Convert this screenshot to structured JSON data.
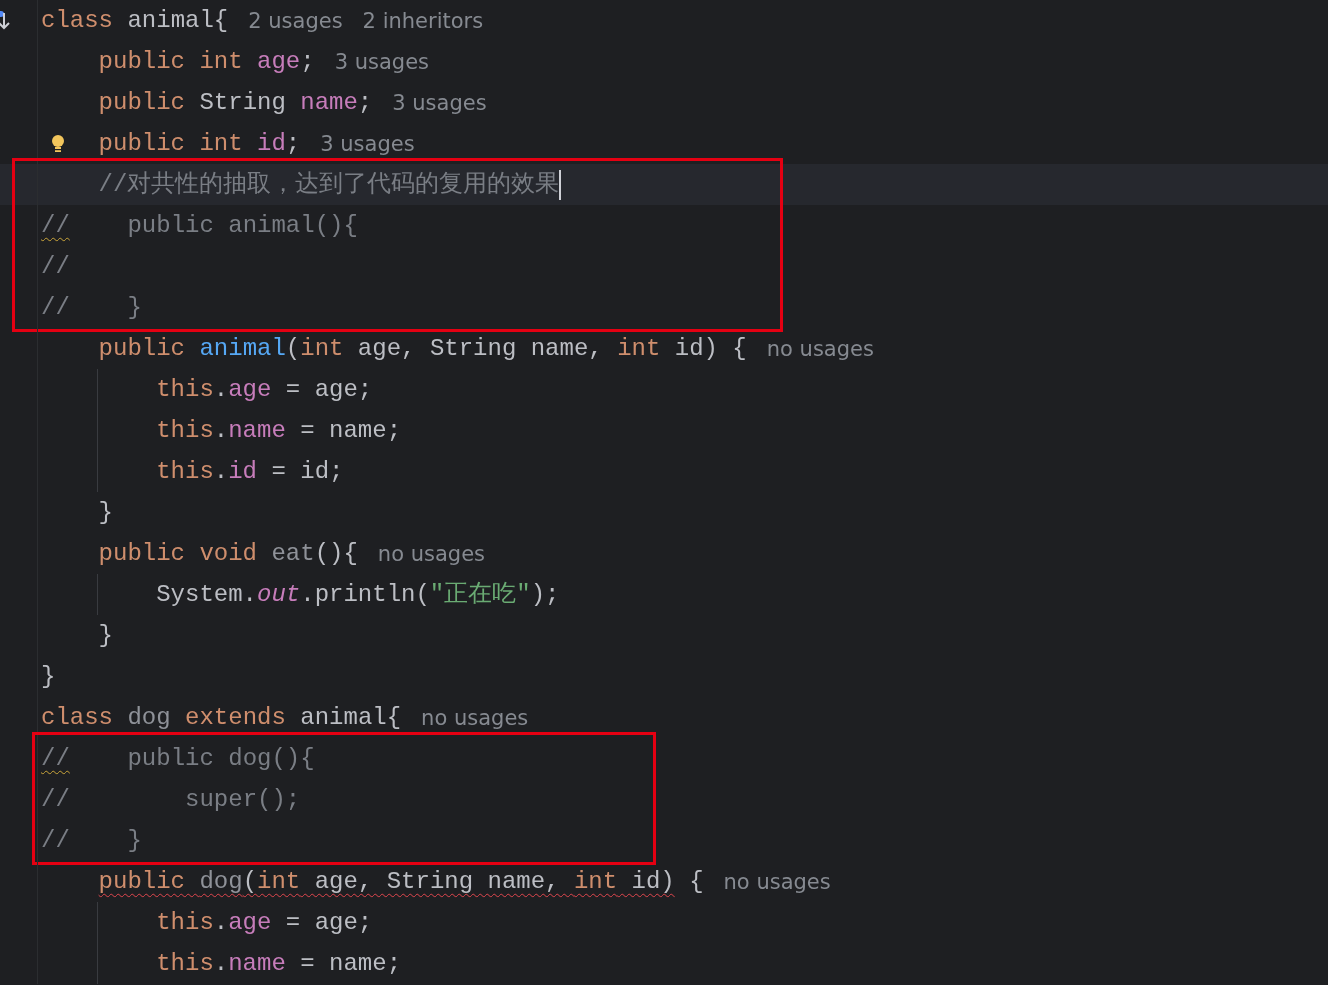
{
  "editor": {
    "blocks": [
      {
        "framed": false,
        "lines": [
          {
            "gutter": {
              "kind": "implemented"
            },
            "current": false,
            "tokens": [
              {
                "t": "class",
                "kind": "keyword"
              },
              {
                "t": " animal{",
                "kind": "plain"
              }
            ],
            "hints": [
              "2 usages",
              "2 inheritors"
            ]
          },
          {
            "current": false,
            "tokens": [
              {
                "t": "    public int ",
                "kind": "keyword"
              },
              {
                "t": "age",
                "kind": "field"
              },
              {
                "t": ";",
                "kind": "plain"
              }
            ],
            "hints": [
              "3 usages"
            ]
          },
          {
            "current": false,
            "tokens": [
              {
                "t": "    public",
                "kind": "keyword"
              },
              {
                "t": " String ",
                "kind": "plain"
              },
              {
                "t": "name",
                "kind": "field"
              },
              {
                "t": ";",
                "kind": "plain"
              }
            ],
            "hints": [
              "3 usages"
            ]
          },
          {
            "gutter": {
              "kind": "bulb"
            },
            "current": false,
            "tokens": [
              {
                "t": "    public int ",
                "kind": "keyword"
              },
              {
                "t": "id",
                "kind": "field"
              },
              {
                "t": ";",
                "kind": "plain"
              }
            ],
            "hints": [
              "3 usages"
            ]
          }
        ]
      },
      {
        "framed": true,
        "lines": [
          {
            "current": true,
            "tokens": [
              {
                "t": "    //对共性的抽取，达到了代码的复用的效果",
                "kind": "comment"
              }
            ]
          },
          {
            "current": false,
            "tokens": [
              {
                "t": "//",
                "kind": "comment",
                "squiggle": {
                  "kind": "warning"
                }
              },
              {
                "t": "    public animal(){",
                "kind": "comment"
              }
            ]
          },
          {
            "current": false,
            "tokens": [
              {
                "t": "//",
                "kind": "comment"
              }
            ]
          },
          {
            "current": false,
            "tokens": [
              {
                "t": "//    }",
                "kind": "comment"
              }
            ]
          }
        ]
      },
      {
        "framed": false,
        "lines": [
          {
            "current": false,
            "tokens": [
              {
                "t": "    public ",
                "kind": "keyword"
              },
              {
                "t": "animal",
                "kind": "declaration"
              },
              {
                "t": "(",
                "kind": "plain"
              },
              {
                "t": "int",
                "kind": "keyword"
              },
              {
                "t": " age, String name, ",
                "kind": "plain"
              },
              {
                "t": "int",
                "kind": "keyword"
              },
              {
                "t": " id) {",
                "kind": "plain"
              }
            ],
            "hints": [
              "no usages"
            ]
          },
          {
            "current": false,
            "tokens": [
              {
                "t": "        this",
                "kind": "keyword"
              },
              {
                "t": ".",
                "kind": "plain"
              },
              {
                "t": "age",
                "kind": "field"
              },
              {
                "t": " = age;",
                "kind": "plain"
              }
            ]
          },
          {
            "current": false,
            "tokens": [
              {
                "t": "        this",
                "kind": "keyword"
              },
              {
                "t": ".",
                "kind": "plain"
              },
              {
                "t": "name",
                "kind": "field"
              },
              {
                "t": " = name;",
                "kind": "plain"
              }
            ]
          },
          {
            "current": false,
            "tokens": [
              {
                "t": "        this",
                "kind": "keyword"
              },
              {
                "t": ".",
                "kind": "plain"
              },
              {
                "t": "id",
                "kind": "field"
              },
              {
                "t": " = id;",
                "kind": "plain"
              }
            ]
          },
          {
            "current": false,
            "tokens": [
              {
                "t": "    }",
                "kind": "plain"
              }
            ]
          },
          {
            "current": false,
            "tokens": [
              {
                "t": "    public void ",
                "kind": "keyword"
              },
              {
                "t": "eat",
                "kind": "unused"
              },
              {
                "t": "(){",
                "kind": "plain"
              }
            ],
            "hints": [
              "no usages"
            ]
          },
          {
            "current": false,
            "tokens": [
              {
                "t": "        System.",
                "kind": "plain"
              },
              {
                "t": "out",
                "kind": "static"
              },
              {
                "t": ".println(",
                "kind": "plain"
              },
              {
                "t": "\"正在吃\"",
                "kind": "string"
              },
              {
                "t": ");",
                "kind": "plain"
              }
            ]
          },
          {
            "current": false,
            "tokens": [
              {
                "t": "    }",
                "kind": "plain"
              }
            ]
          },
          {
            "current": false,
            "tokens": [
              {
                "t": "}",
                "kind": "plain"
              }
            ]
          },
          {
            "current": false,
            "tokens": [
              {
                "t": "class ",
                "kind": "keyword"
              },
              {
                "t": "dog",
                "kind": "unused"
              },
              {
                "t": " extends ",
                "kind": "keyword"
              },
              {
                "t": "animal{",
                "kind": "plain"
              }
            ],
            "hints": [
              "no usages"
            ]
          }
        ]
      },
      {
        "framed": true,
        "lines": [
          {
            "current": false,
            "tokens": [
              {
                "t": "//",
                "kind": "comment",
                "squiggle": {
                  "kind": "warning"
                }
              },
              {
                "t": "    public dog(){",
                "kind": "comment"
              }
            ]
          },
          {
            "current": false,
            "tokens": [
              {
                "t": "//        super();",
                "kind": "comment"
              }
            ]
          },
          {
            "current": false,
            "tokens": [
              {
                "t": "//    }",
                "kind": "comment"
              }
            ]
          }
        ]
      },
      {
        "framed": false,
        "lines": [
          {
            "current": false,
            "tokens": [
              {
                "t": "    public ",
                "kind": "keyword",
                "squiggle": {
                  "kind": "error"
                }
              },
              {
                "t": "dog",
                "kind": "unused",
                "squiggle": {
                  "kind": "error"
                }
              },
              {
                "t": "(",
                "kind": "plain",
                "squiggle": {
                  "kind": "error"
                }
              },
              {
                "t": "int",
                "kind": "keyword",
                "squiggle": {
                  "kind": "error"
                }
              },
              {
                "t": " age, String name, ",
                "kind": "plain",
                "squiggle": {
                  "kind": "error"
                }
              },
              {
                "t": "int",
                "kind": "keyword",
                "squiggle": {
                  "kind": "error"
                }
              },
              {
                "t": " id)",
                "kind": "plain",
                "squiggle": {
                  "kind": "error"
                }
              },
              {
                "t": " {",
                "kind": "plain"
              }
            ],
            "hints": [
              "no usages"
            ]
          },
          {
            "current": false,
            "tokens": [
              {
                "t": "        this",
                "kind": "keyword"
              },
              {
                "t": ".",
                "kind": "plain"
              },
              {
                "t": "age",
                "kind": "field"
              },
              {
                "t": " = age;",
                "kind": "plain"
              }
            ]
          },
          {
            "current": false,
            "tokens": [
              {
                "t": "        this",
                "kind": "keyword"
              },
              {
                "t": ".",
                "kind": "plain"
              },
              {
                "t": "name",
                "kind": "field"
              },
              {
                "t": " = name;",
                "kind": "plain"
              }
            ]
          }
        ]
      }
    ]
  }
}
